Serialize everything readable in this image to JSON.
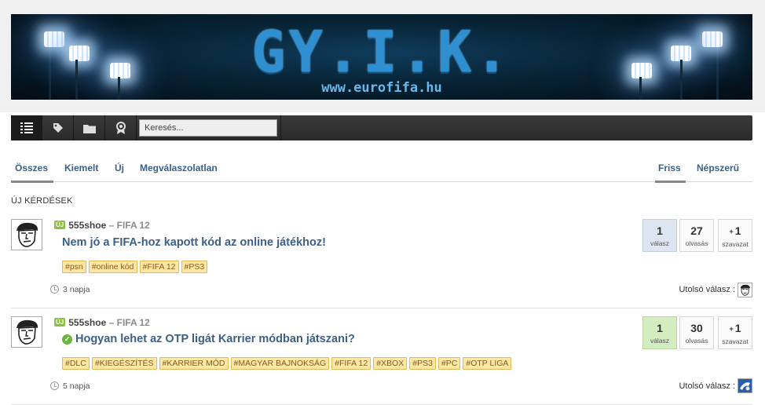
{
  "banner": {
    "title": "GY.I.K.",
    "url": "www.eurofifa.hu"
  },
  "toolbar": {
    "buttons": [
      {
        "icon": "list-icon",
        "active": true
      },
      {
        "icon": "tag-icon",
        "active": false
      },
      {
        "icon": "folder-icon",
        "active": false
      },
      {
        "icon": "badge-icon",
        "active": false
      }
    ],
    "search_placeholder": "Keresés..."
  },
  "tabs": {
    "left": [
      "Összes",
      "Kiemelt",
      "Új",
      "Megválaszolatlan"
    ],
    "right": [
      "Friss",
      "Népszerű"
    ],
    "active_left": "Összes",
    "active_right": "Friss"
  },
  "section_title": "ÚJ KÉRDÉSEK",
  "questions": [
    {
      "badge": "ÚJ",
      "author": "555shoe",
      "category": "FIFA 12",
      "title": "Nem jó a FIFA-hoz kapott kód az online játékhoz!",
      "solved": false,
      "tags": [
        "#psn",
        "#online kód",
        "#FIFA 12",
        "#PS3"
      ],
      "answers": "1",
      "answers_label": "válasz",
      "views": "27",
      "views_label": "olvasás",
      "votes_sign": "+",
      "votes": "1",
      "votes_label": "szavazat",
      "time": "3 napja",
      "last_answer_label": "Utolsó válasz :"
    },
    {
      "badge": "ÚJ",
      "author": "555shoe",
      "category": "FIFA 12",
      "title": "Hogyan lehet az OTP ligát Karrier módban játszani?",
      "solved": true,
      "tags": [
        "#DLC",
        "#KIEGÉSZÍTÉS",
        "#KARRIER MÓD",
        "#MAGYAR BAJNOKSÁG",
        "#FIFA 12",
        "#XBOX",
        "#PS3",
        "#PC",
        "#OTP LIGA"
      ],
      "answers": "1",
      "answers_label": "válasz",
      "views": "30",
      "views_label": "olvasás",
      "votes_sign": "+",
      "votes": "1",
      "votes_label": "szavazat",
      "time": "5 napja",
      "last_answer_label": "Utolsó válasz :"
    }
  ],
  "colors": {
    "link": "#3b5f86",
    "tag_bg": "#fde7a6",
    "accepted_bg": "#d3ecc0",
    "answers_bg": "#dde6f0",
    "new_badge": "#8cbf3f"
  }
}
